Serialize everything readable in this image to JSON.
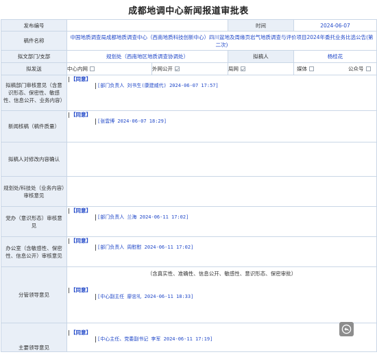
{
  "title": "成都地调中心新闻报道审批表",
  "rows": {
    "issue_no": {
      "label": "发布编号",
      "value": ""
    },
    "time": {
      "label": "时间",
      "value": "2024-06-07"
    },
    "manuscript": {
      "label": "稿件名称",
      "value": "中国地质调查局成都地质调查中心（西南地质科技创新中心）四川盆地及周缘页岩气地质调查与评价项目2024年委托业务比选公告(第二次)"
    },
    "dept": {
      "label": "拟文部门/支部",
      "value": "规划处（西南地区地质调查协调处）"
    },
    "author": {
      "label": "拟稿人",
      "value": "杨桂花"
    },
    "publish_to": {
      "label": "拟发送",
      "options": [
        {
          "label": "中心内网",
          "checked": false
        },
        {
          "label": "外网公开",
          "checked": true
        },
        {
          "label": "局网",
          "checked": true
        },
        {
          "label": "媒体",
          "checked": false
        },
        {
          "label": "公众号",
          "checked": false
        }
      ]
    },
    "dept_review": {
      "label": "拟稿部门审核意见（含意识形态、保密性、敏感性、信息公开、业务内容）",
      "tag": "【同意】",
      "sign": "[部门负责人 刘书生(康建威代) 2024-06-07 17:57]"
    },
    "news_review": {
      "label": "新闻核稿（稿件质量）",
      "tag": "【同意】",
      "sign": "[张雲博 2024-06-07 18:29]"
    },
    "author_confirm": {
      "label": "拟稿人对修改内容确认"
    },
    "planning_review": {
      "label": "规划处/科技处（业务内容）审核意见"
    },
    "party_office": {
      "label": "党办（意识形态）审核意见",
      "tag": "【同意】",
      "sign": "[部门负责人 兰海 2024-06-11 17:02]"
    },
    "general_office": {
      "label": "办公室（含敏感性、保密性、信息公开）审核意见",
      "tag": "【同意】",
      "sign": "[部门负责人 周慰慰 2024-06-11 17:02]"
    },
    "leader_review": {
      "label": "分管领导意见",
      "note": "（含真实性、准确性、信息公开、敏感性、意识形态、保密审批）",
      "tag": "【同意】",
      "sign": "[中心副主任 廖忠礼 2024-06-11 18:33]"
    },
    "chief_review": {
      "label": "主要领导意见",
      "tag": "【同意】",
      "sign": "[中心主任、党委副书记 李军 2024-06-11 17:19]"
    }
  }
}
